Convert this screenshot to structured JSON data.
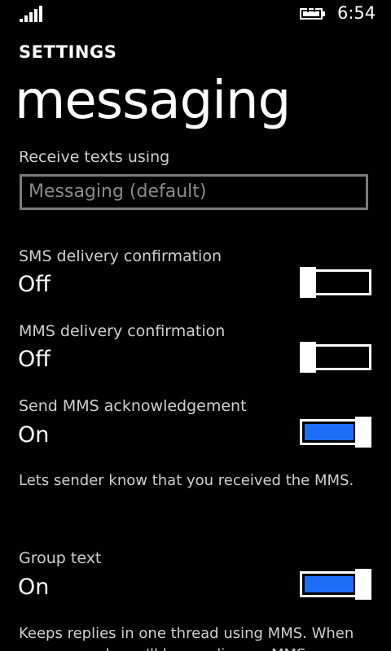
{
  "status": {
    "time": "6:54",
    "signal_icon": "signal-bars-icon",
    "battery_icon": "battery-charging-icon"
  },
  "header": {
    "app_title": "SETTINGS",
    "page_title": "messaging"
  },
  "receive_texts": {
    "label": "Receive texts using",
    "value": "Messaging (default)"
  },
  "sms_delivery": {
    "label": "SMS delivery confirmation",
    "state": "Off"
  },
  "mms_delivery": {
    "label": "MMS delivery confirmation",
    "state": "Off"
  },
  "mms_ack": {
    "label": "Send MMS acknowledgement",
    "state": "On",
    "description": "Lets sender know that you received the MMS."
  },
  "group_text": {
    "label": "Group text",
    "state": "On",
    "description": "Keeps replies in one thread using MMS. When you respond, you'll be sending an MMS."
  },
  "colors": {
    "accent": "#1e6ef5",
    "background": "#000000"
  }
}
